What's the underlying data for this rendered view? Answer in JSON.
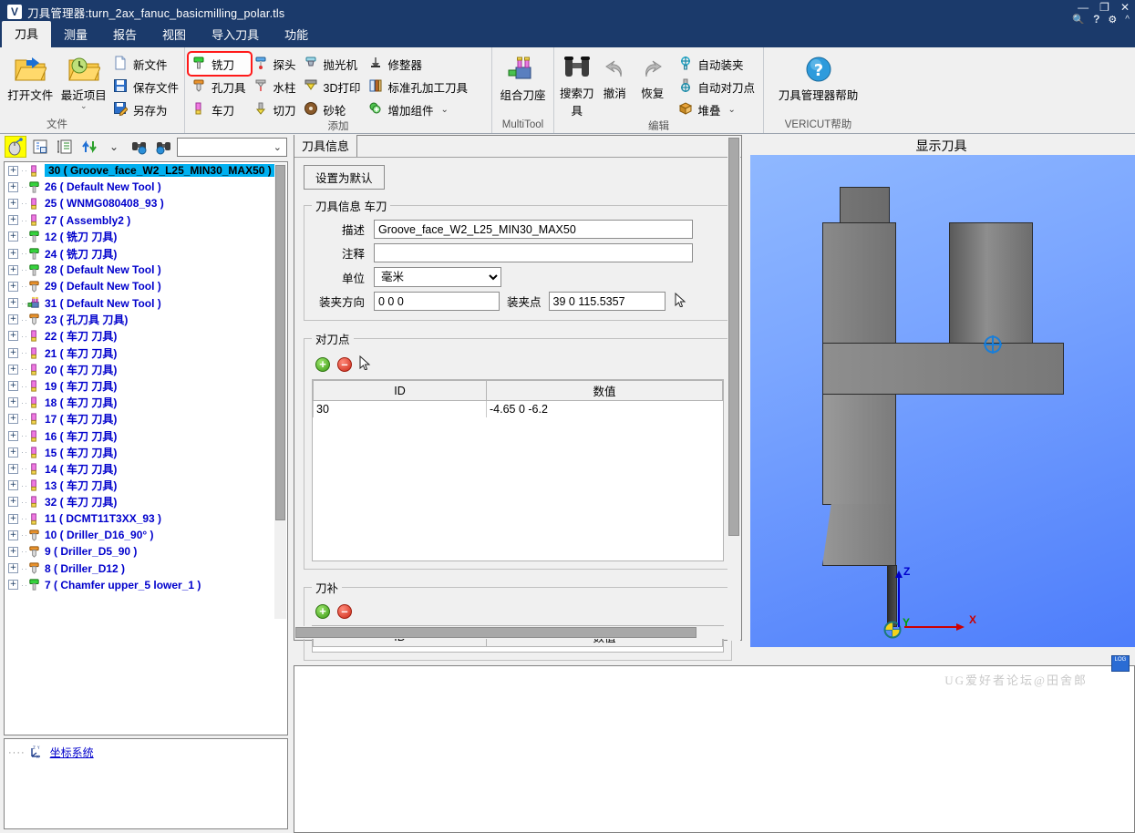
{
  "window": {
    "logo": "V",
    "title": "刀具管理器:turn_2ax_fanuc_basicmilling_polar.tls",
    "controls": {
      "minimize": "—",
      "maximize": "❐",
      "close": "✕"
    },
    "tray": {
      "search": "search-icon",
      "help": "?",
      "settings": "gear-icon",
      "collapse": "^"
    }
  },
  "menubar": {
    "items": [
      {
        "label": "刀具",
        "active": true
      },
      {
        "label": "测量",
        "active": false
      },
      {
        "label": "报告",
        "active": false
      },
      {
        "label": "视图",
        "active": false
      },
      {
        "label": "导入刀具",
        "active": false
      },
      {
        "label": "功能",
        "active": false
      }
    ]
  },
  "ribbon": {
    "groups": [
      {
        "label": "文件",
        "big": [
          {
            "label": "打开文件",
            "icon": "open-folder-icon"
          },
          {
            "label": "最近项目",
            "icon": "recent-folder-icon",
            "dropdown": "⌄"
          }
        ],
        "small": [
          {
            "label": "新文件",
            "icon": "new-file-icon"
          },
          {
            "label": "保存文件",
            "icon": "save-icon"
          },
          {
            "label": "另存为",
            "icon": "save-as-icon"
          }
        ]
      },
      {
        "label": "添加",
        "columns": [
          [
            {
              "label": "铣刀",
              "icon": "mill-tool-icon",
              "highlight": true
            },
            {
              "label": "孔刀具",
              "icon": "hole-tool-icon"
            },
            {
              "label": "车刀",
              "icon": "turn-tool-icon"
            }
          ],
          [
            {
              "label": "探头",
              "icon": "probe-icon"
            },
            {
              "label": "水柱",
              "icon": "waterjet-icon"
            },
            {
              "label": "切刀",
              "icon": "cutter-icon"
            }
          ],
          [
            {
              "label": "抛光机",
              "icon": "polisher-icon"
            },
            {
              "label": "3D打印",
              "icon": "3d-print-icon"
            },
            {
              "label": "砂轮",
              "icon": "grinding-wheel-icon"
            }
          ],
          [
            {
              "label": "修整器",
              "icon": "dresser-icon"
            },
            {
              "label": "标准孔加工刀具",
              "icon": "standard-hole-tool-icon"
            },
            {
              "label": "增加组件",
              "icon": "add-component-icon",
              "dropdown": "⌄"
            }
          ]
        ]
      },
      {
        "label": "MultiTool",
        "big": [
          {
            "label": "组合刀座",
            "icon": "multitool-icon"
          }
        ]
      },
      {
        "label": "编辑",
        "big": [
          {
            "label": "搜索刀具",
            "icon": "binoculars-icon"
          },
          {
            "label": "撤消",
            "icon": "undo-icon",
            "disabled": true
          },
          {
            "label": "恢复",
            "icon": "redo-icon",
            "disabled": true
          }
        ],
        "small": [
          {
            "label": "自动装夹",
            "icon": "auto-clamp-icon"
          },
          {
            "label": "自动对刀点",
            "icon": "auto-gauge-point-icon"
          },
          {
            "label": "堆叠",
            "icon": "stack-icon",
            "dropdown": "⌄"
          }
        ]
      },
      {
        "label": "VERICUT帮助",
        "big": [
          {
            "label": "刀具管理器帮助",
            "icon": "help-question-icon"
          }
        ]
      }
    ]
  },
  "tree_toolbar": {
    "buttons": [
      {
        "icon": "mouse-select-icon",
        "selected": true
      },
      {
        "icon": "list-detail-icon",
        "selected": false
      },
      {
        "icon": "list-expand-icon",
        "selected": false
      },
      {
        "icon": "sort-updown-icon",
        "selected": false
      },
      {
        "icon": "chevron-down-icon",
        "selected": false
      },
      {
        "icon": "find-prev-icon",
        "selected": false
      },
      {
        "icon": "find-next-icon",
        "selected": false
      }
    ],
    "combo": {
      "value": "",
      "arrow": "⌄"
    }
  },
  "tree": {
    "items": [
      {
        "id": "30",
        "name": "( Groove_face_W2_L25_MIN30_MAX50 )",
        "icon": "turn-tool-icon",
        "selected": true
      },
      {
        "id": "26",
        "name": "( Default New Tool )",
        "icon": "mill-tool-icon",
        "selected": false
      },
      {
        "id": "25",
        "name": "( WNMG080408_93 )",
        "icon": "turn-tool-icon",
        "selected": false
      },
      {
        "id": "27",
        "name": "( Assembly2 )",
        "icon": "turn-tool-icon",
        "selected": false
      },
      {
        "id": "12",
        "name": "( 铣刀 刀具)",
        "icon": "mill-tool-icon",
        "selected": false
      },
      {
        "id": "24",
        "name": "( 铣刀 刀具)",
        "icon": "mill-tool-icon",
        "selected": false
      },
      {
        "id": "28",
        "name": "( Default New Tool )",
        "icon": "mill-tool-icon",
        "selected": false
      },
      {
        "id": "29",
        "name": "( Default New Tool )",
        "icon": "hole-tool-icon",
        "selected": false
      },
      {
        "id": "31",
        "name": "( Default New Tool )",
        "icon": "multitool-icon",
        "selected": false
      },
      {
        "id": "23",
        "name": "( 孔刀具 刀具)",
        "icon": "hole-tool-icon",
        "selected": false
      },
      {
        "id": "22",
        "name": "( 车刀 刀具)",
        "icon": "turn-tool-icon",
        "selected": false
      },
      {
        "id": "21",
        "name": "( 车刀 刀具)",
        "icon": "turn-tool-icon",
        "selected": false
      },
      {
        "id": "20",
        "name": "( 车刀 刀具)",
        "icon": "turn-tool-icon",
        "selected": false
      },
      {
        "id": "19",
        "name": "( 车刀 刀具)",
        "icon": "turn-tool-icon",
        "selected": false
      },
      {
        "id": "18",
        "name": "( 车刀 刀具)",
        "icon": "turn-tool-icon",
        "selected": false
      },
      {
        "id": "17",
        "name": "( 车刀 刀具)",
        "icon": "turn-tool-icon",
        "selected": false
      },
      {
        "id": "16",
        "name": "( 车刀 刀具)",
        "icon": "turn-tool-icon",
        "selected": false
      },
      {
        "id": "15",
        "name": "( 车刀 刀具)",
        "icon": "turn-tool-icon",
        "selected": false
      },
      {
        "id": "14",
        "name": "( 车刀 刀具)",
        "icon": "turn-tool-icon",
        "selected": false
      },
      {
        "id": "13",
        "name": "( 车刀 刀具)",
        "icon": "turn-tool-icon",
        "selected": false
      },
      {
        "id": "32",
        "name": "( 车刀 刀具)",
        "icon": "turn-tool-icon",
        "selected": false
      },
      {
        "id": "11",
        "name": "( DCMT11T3XX_93 )",
        "icon": "turn-tool-icon",
        "selected": false
      },
      {
        "id": "10",
        "name": "( Driller_D16_90° )",
        "icon": "hole-tool-icon",
        "selected": false
      },
      {
        "id": "9",
        "name": "( Driller_D5_90 )",
        "icon": "hole-tool-icon",
        "selected": false
      },
      {
        "id": "8",
        "name": "( Driller_D12 )",
        "icon": "hole-tool-icon",
        "selected": false
      },
      {
        "id": "7",
        "name": "( Chamfer upper_5 lower_1 )",
        "icon": "mill-tool-icon",
        "selected": false
      }
    ]
  },
  "coordinate_panel": {
    "label": "坐标系统",
    "icon": "axes-icon"
  },
  "tool_info": {
    "tab_label": "刀具信息",
    "default_button": "设置为默认",
    "group_label": "刀具信息 车刀",
    "fields": {
      "desc_label": "描述",
      "desc_value": "Groove_face_W2_L25_MIN30_MAX50",
      "comment_label": "注释",
      "comment_value": "",
      "unit_label": "单位",
      "unit_value": "毫米",
      "mount_dir_label": "装夹方向",
      "mount_dir_value": "0 0 0",
      "mount_point_label": "装夹点",
      "mount_point_value": "39 0 115.5357"
    }
  },
  "gauge_point": {
    "group_label": "对刀点",
    "add_icon": "add-icon",
    "remove_icon": "remove-icon",
    "columns": [
      "ID",
      "数值"
    ],
    "rows": [
      {
        "id": "30",
        "value": "-4.65 0 -6.2"
      }
    ]
  },
  "tool_comp": {
    "group_label": "刀补",
    "add_icon": "add-icon",
    "remove_icon": "remove-icon",
    "columns": [
      "ID",
      "数值"
    ],
    "rows": []
  },
  "viewport": {
    "title": "显示刀具",
    "axes": {
      "x": "X",
      "y": "Y",
      "z": "Z"
    },
    "colors": {
      "x_axis": "#cc0000",
      "y_axis": "#00a000",
      "z_axis": "#0000cc",
      "background_top": "#8fb8ff",
      "background_bottom": "#4d7dfb",
      "part": "#7d7d7d"
    }
  },
  "watermark": "UG爱好者论坛@田舍郎",
  "log_button": "LOG"
}
